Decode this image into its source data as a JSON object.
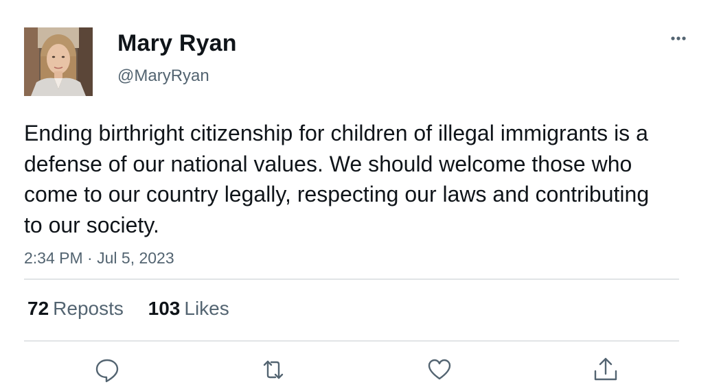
{
  "author": {
    "display_name": "Mary Ryan",
    "handle": "@MaryRyan",
    "avatar_alt": "Profile photo of Mary Ryan"
  },
  "tweet": {
    "text": "Ending birthright citizenship for children of illegal immigrants is a defense of our national values. We should welcome those who come to our country legally, respecting our laws and contributing to our society.",
    "time": "2:34 PM",
    "separator": "·",
    "date": "Jul 5, 2023"
  },
  "stats": {
    "reposts_count": "72",
    "reposts_label": "Reposts",
    "likes_count": "103",
    "likes_label": "Likes"
  },
  "icons": {
    "more": "more-horizontal-icon",
    "reply": "reply-icon",
    "repost": "repost-icon",
    "like": "heart-icon",
    "share": "share-icon"
  },
  "colors": {
    "text_primary": "#0f1419",
    "text_secondary": "#536471",
    "divider": "#e1e4e6"
  }
}
